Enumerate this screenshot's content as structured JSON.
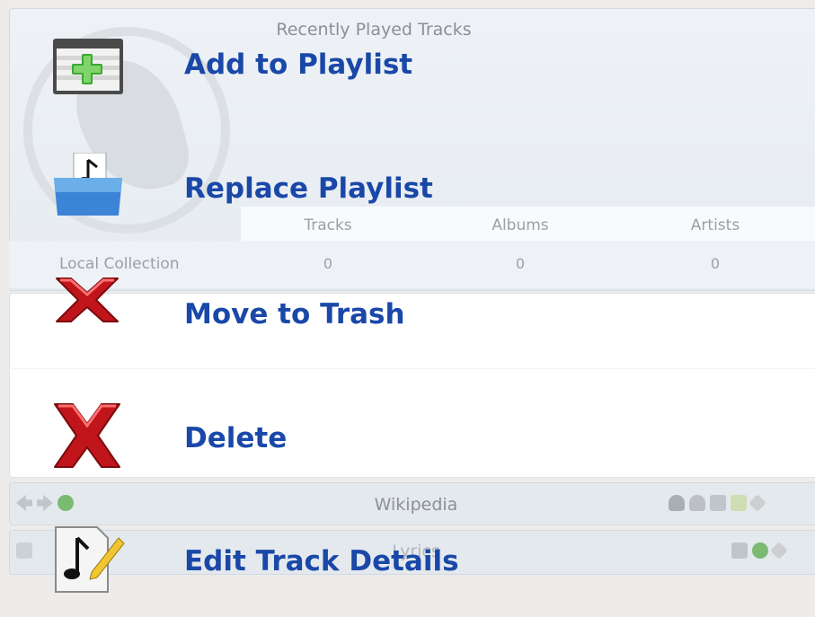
{
  "recently_played": {
    "title": "Recently Played Tracks"
  },
  "collection": {
    "columns": [
      "Tracks",
      "Albums",
      "Artists"
    ],
    "row_label": "Local Collection",
    "values": [
      "0",
      "0",
      "0"
    ]
  },
  "wikipedia": {
    "title": "Wikipedia"
  },
  "lyrics": {
    "title": "Lyrics"
  },
  "context_menu": {
    "items": [
      {
        "label": "Add to Playlist",
        "icon": "add-to-playlist-icon"
      },
      {
        "label": "Replace Playlist",
        "icon": "replace-playlist-icon"
      },
      {
        "label": "Move to Trash",
        "icon": "trash-icon"
      },
      {
        "label": "Delete",
        "icon": "delete-icon"
      },
      {
        "label": "Edit Track Details",
        "icon": "edit-track-icon"
      }
    ]
  },
  "colors": {
    "menu_text": "#1a48a8",
    "panel_bg": "#eef2f6",
    "delete_red": "#d01818"
  }
}
